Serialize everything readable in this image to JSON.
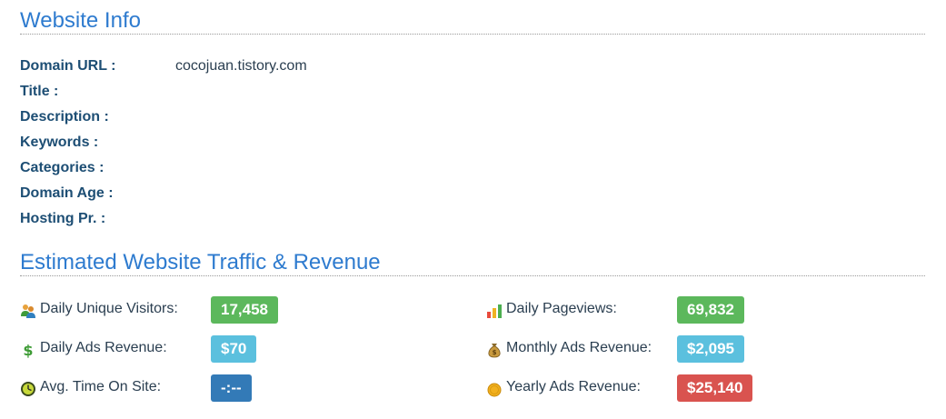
{
  "website_info": {
    "title": "Website Info",
    "rows": [
      {
        "label": "Domain URL :",
        "value": "cocojuan.tistory.com"
      },
      {
        "label": "Title :",
        "value": ""
      },
      {
        "label": "Description :",
        "value": ""
      },
      {
        "label": "Keywords :",
        "value": ""
      },
      {
        "label": "Categories :",
        "value": ""
      },
      {
        "label": "Domain Age :",
        "value": ""
      },
      {
        "label": "Hosting Pr. :",
        "value": ""
      }
    ]
  },
  "traffic": {
    "title": "Estimated Website Traffic & Revenue",
    "stats": [
      {
        "label": "Daily Unique Visitors:",
        "value": "17,458",
        "icon": "visitors-icon",
        "color": "#5cb85c"
      },
      {
        "label": "Daily Pageviews:",
        "value": "69,832",
        "icon": "bar-chart-icon",
        "color": "#5cb85c"
      },
      {
        "label": "Daily Ads Revenue:",
        "value": "$70",
        "icon": "dollar-icon",
        "color": "#5bc0de"
      },
      {
        "label": "Monthly Ads Revenue:",
        "value": "$2,095",
        "icon": "money-bag-icon",
        "color": "#5bc0de"
      },
      {
        "label": "Avg. Time On Site:",
        "value": "-:--",
        "icon": "clock-icon",
        "color": "#337ab7"
      },
      {
        "label": "Yearly Ads Revenue:",
        "value": "$25,140",
        "icon": "gold-coin-icon",
        "color": "#d9534f"
      }
    ]
  }
}
